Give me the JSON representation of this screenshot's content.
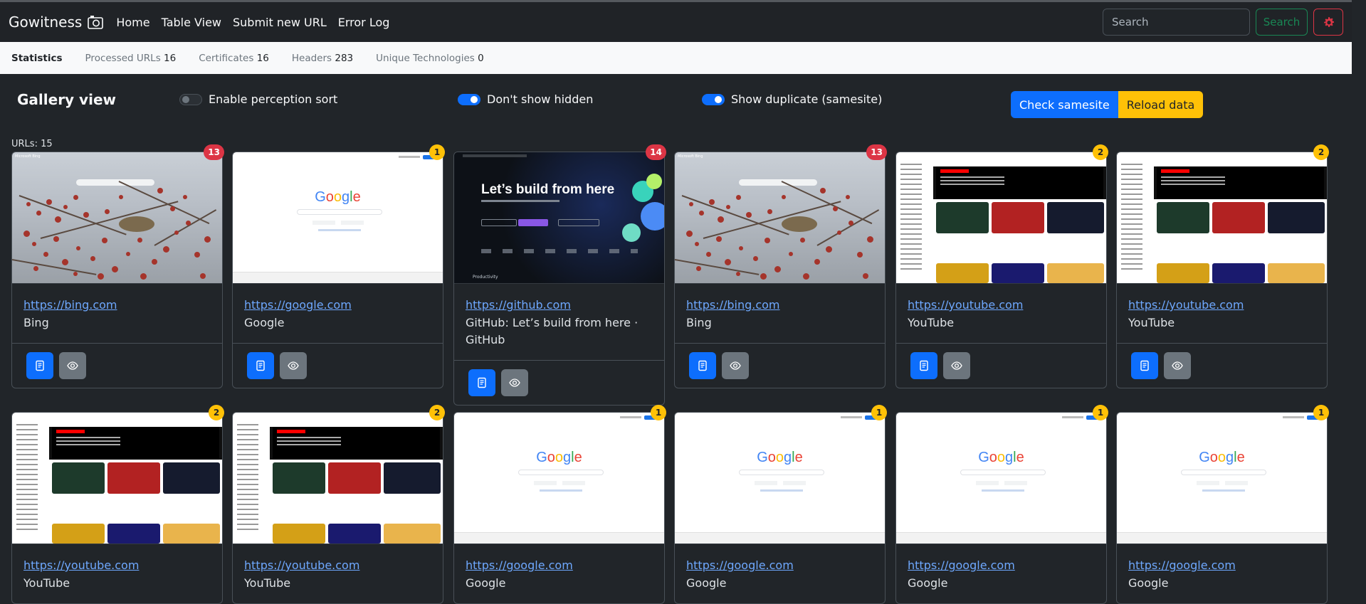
{
  "nav": {
    "brand": "Gowitness",
    "links": [
      "Home",
      "Table View",
      "Submit new URL",
      "Error Log"
    ],
    "search_placeholder": "Search",
    "search_button": "Search"
  },
  "stats": {
    "title": "Statistics",
    "items": [
      {
        "label": "Processed URLs",
        "value": "16"
      },
      {
        "label": "Certificates",
        "value": "16"
      },
      {
        "label": "Headers",
        "value": "283"
      },
      {
        "label": "Unique Technologies",
        "value": "0"
      }
    ]
  },
  "gallery": {
    "title": "Gallery view",
    "toggles": [
      {
        "label": "Enable perception sort",
        "on": false
      },
      {
        "label": "Don't show hidden",
        "on": true
      },
      {
        "label": "Show duplicate (samesite)",
        "on": true
      }
    ],
    "check_samesite": "Check samesite",
    "reload_data": "Reload data",
    "urls_count": "URLs: 15"
  },
  "colors": {
    "badge_yellow": "#ffc107",
    "badge_red": "#dc3545",
    "primary": "#0d6efd",
    "link": "#6ea8fe"
  },
  "icons": {
    "brand": "camera-icon",
    "settings": "gear-icon",
    "details": "document-icon",
    "view": "eye-icon"
  },
  "cards": [
    {
      "url": "https://bing.com",
      "title": "Bing",
      "badge": "13",
      "badge_color": "red",
      "thumb": "bing"
    },
    {
      "url": "https://google.com",
      "title": "Google",
      "badge": "1",
      "badge_color": "yellow",
      "thumb": "google"
    },
    {
      "url": "https://github.com",
      "title": "GitHub: Let’s build from here · GitHub",
      "badge": "14",
      "badge_color": "red",
      "thumb": "github"
    },
    {
      "url": "https://bing.com",
      "title": "Bing",
      "badge": "13",
      "badge_color": "red",
      "thumb": "bing"
    },
    {
      "url": "https://youtube.com",
      "title": "YouTube",
      "badge": "2",
      "badge_color": "yellow",
      "thumb": "youtube"
    },
    {
      "url": "https://youtube.com",
      "title": "YouTube",
      "badge": "2",
      "badge_color": "yellow",
      "thumb": "youtube"
    },
    {
      "url": "https://youtube.com",
      "title": "YouTube",
      "badge": "2",
      "badge_color": "yellow",
      "thumb": "youtube"
    },
    {
      "url": "https://youtube.com",
      "title": "YouTube",
      "badge": "2",
      "badge_color": "yellow",
      "thumb": "youtube"
    },
    {
      "url": "https://google.com",
      "title": "Google",
      "badge": "1",
      "badge_color": "yellow",
      "thumb": "google"
    },
    {
      "url": "https://google.com",
      "title": "Google",
      "badge": "1",
      "badge_color": "yellow",
      "thumb": "google"
    },
    {
      "url": "https://google.com",
      "title": "Google",
      "badge": "1",
      "badge_color": "yellow",
      "thumb": "google"
    },
    {
      "url": "https://google.com",
      "title": "Google",
      "badge": "1",
      "badge_color": "yellow",
      "thumb": "google"
    }
  ],
  "thumb_text": {
    "bing_brand": "Microsoft Bing",
    "github_title": "Let’s build from here",
    "github_product": "Productivity",
    "google_logo": [
      "G",
      "o",
      "o",
      "g",
      "l",
      "e"
    ]
  }
}
